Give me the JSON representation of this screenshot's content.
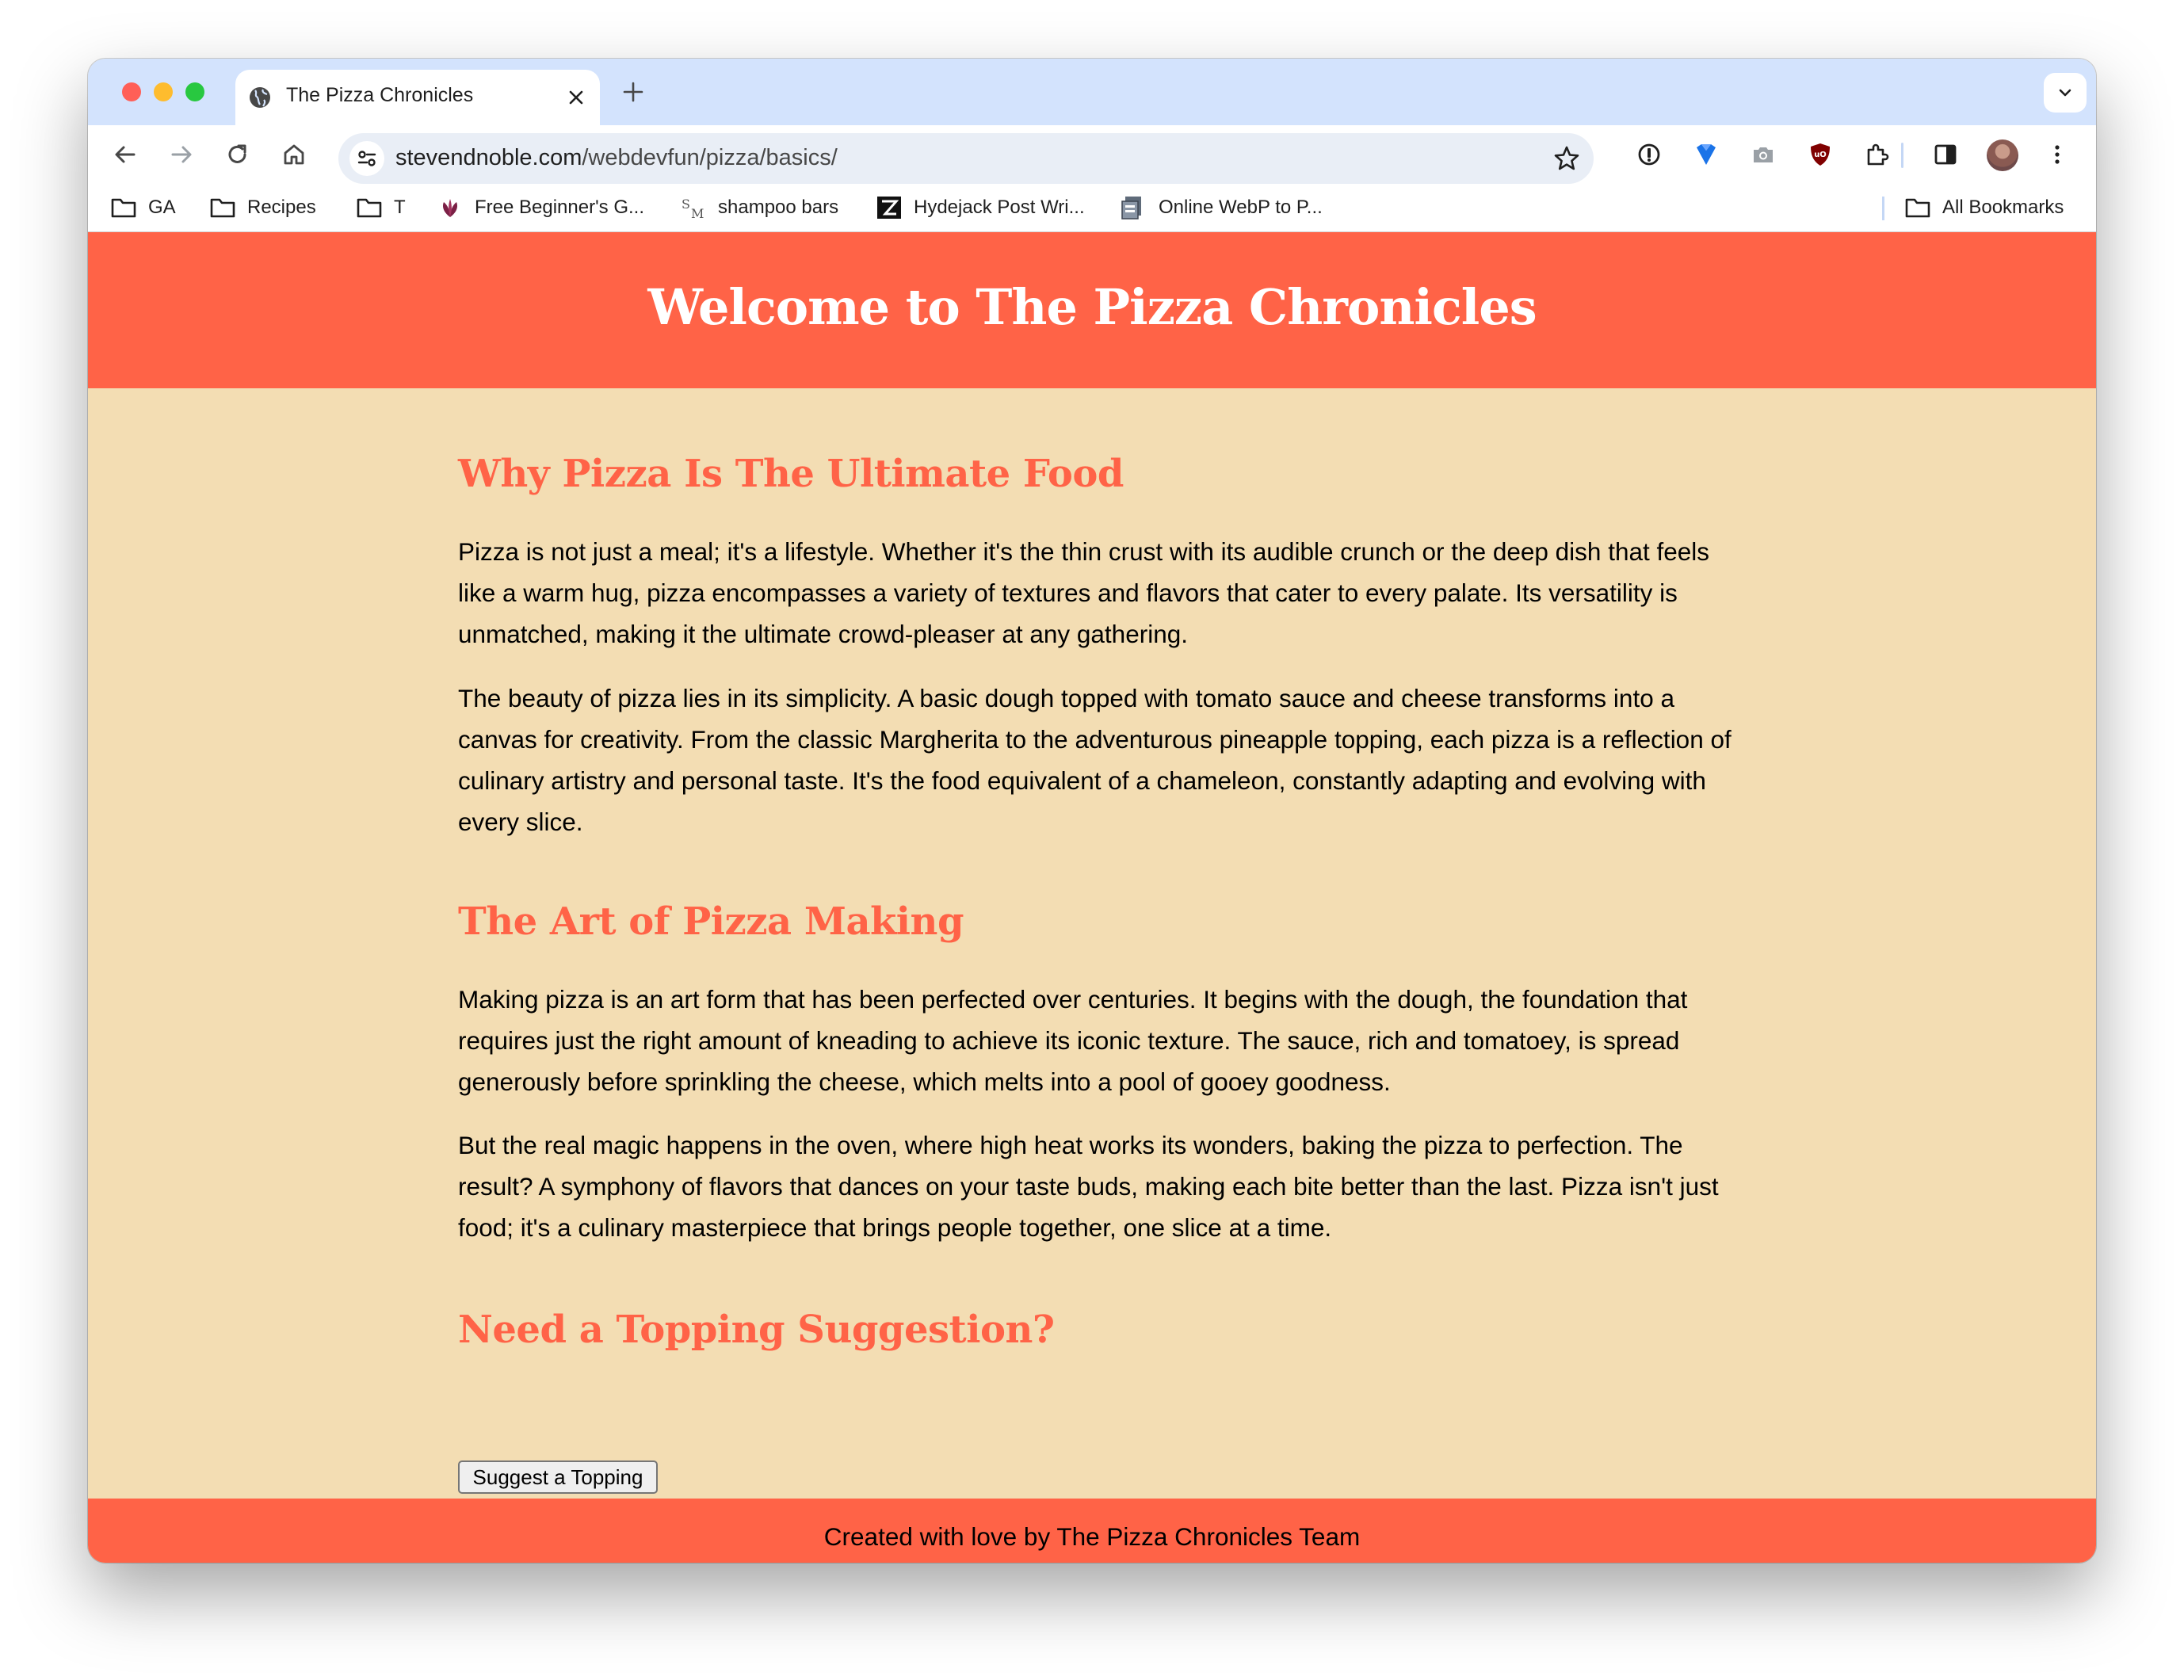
{
  "browser": {
    "tab": {
      "title": "The Pizza Chronicles"
    },
    "address_bar": {
      "domain": "stevendnoble.com",
      "path": "/webdevfun/pizza/basics/"
    },
    "bookmarks": [
      {
        "label": "GA",
        "icon": "folder-icon"
      },
      {
        "label": "Recipes",
        "icon": "folder-icon"
      },
      {
        "label": "T",
        "icon": "folder-icon"
      },
      {
        "label": "Free Beginner's G...",
        "icon": "leaf-icon"
      },
      {
        "label": "shampoo bars",
        "icon": "sm-logo-icon"
      },
      {
        "label": "Hydejack Post Wri...",
        "icon": "hydejack-icon"
      },
      {
        "label": "Online WebP to P...",
        "icon": "converter-icon"
      }
    ],
    "all_bookmarks": "All Bookmarks",
    "colors": {
      "tab_strip": "#d3e3fd",
      "omnibox": "#e9eef6"
    }
  },
  "page": {
    "header_title": "Welcome to The Pizza Chronicles",
    "sections": [
      {
        "heading": "Why Pizza Is The Ultimate Food",
        "paragraphs": [
          "Pizza is not just a meal; it's a lifestyle. Whether it's the thin crust with its audible crunch or the deep dish that feels like a warm hug, pizza encompasses a variety of textures and flavors that cater to every palate. Its versatility is unmatched, making it the ultimate crowd-pleaser at any gathering.",
          "The beauty of pizza lies in its simplicity. A basic dough topped with tomato sauce and cheese transforms into a canvas for creativity. From the classic Margherita to the adventurous pineapple topping, each pizza is a reflection of culinary artistry and personal taste. It's the food equivalent of a chameleon, constantly adapting and evolving with every slice."
        ]
      },
      {
        "heading": "The Art of Pizza Making",
        "paragraphs": [
          "Making pizza is an art form that has been perfected over centuries. It begins with the dough, the foundation that requires just the right amount of kneading to achieve its iconic texture. The sauce, rich and tomatoey, is spread generously before sprinkling the cheese, which melts into a pool of gooey goodness.",
          "But the real magic happens in the oven, where high heat works its wonders, baking the pizza to perfection. The result? A symphony of flavors that dances on your taste buds, making each bite better than the last. Pizza isn't just food; it's a culinary masterpiece that brings people together, one slice at a time."
        ]
      },
      {
        "heading": "Need a Topping Suggestion?"
      }
    ],
    "suggest_button": "Suggest a Topping",
    "footer_text": "Created with love by The Pizza Chronicles Team",
    "colors": {
      "accent": "#ff6347",
      "background": "#f3ddb3",
      "header_text": "#ffffff"
    }
  }
}
